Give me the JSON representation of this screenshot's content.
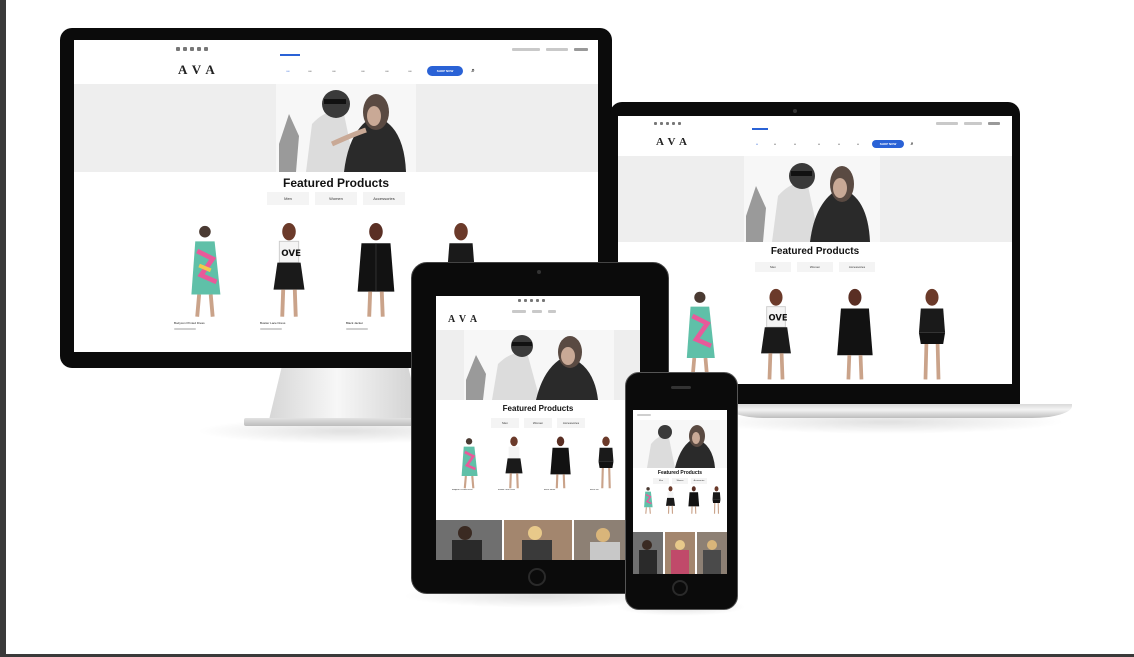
{
  "brand": {
    "logo": "AVA",
    "accent": "#2a62d6"
  },
  "section": {
    "title": "Featured Products",
    "tabs": [
      "Men",
      "Women",
      "Accessories"
    ]
  },
  "shop_button": "SHOP NOW",
  "products": [
    {
      "name": "Bodycon Printed Dress",
      "image": "printed-dress"
    },
    {
      "name": "Bustier Lace Dress",
      "image": "love-tee-outfit"
    },
    {
      "name": "Black Jacket",
      "image": "black-jacket"
    },
    {
      "name": "Black Tee",
      "image": "black-tee"
    }
  ],
  "devices": [
    "desktop-monitor",
    "laptop",
    "tablet",
    "phone"
  ],
  "icons": [
    "camera-icon",
    "home-button-icon",
    "speaker-icon",
    "apple-stand-icon"
  ]
}
